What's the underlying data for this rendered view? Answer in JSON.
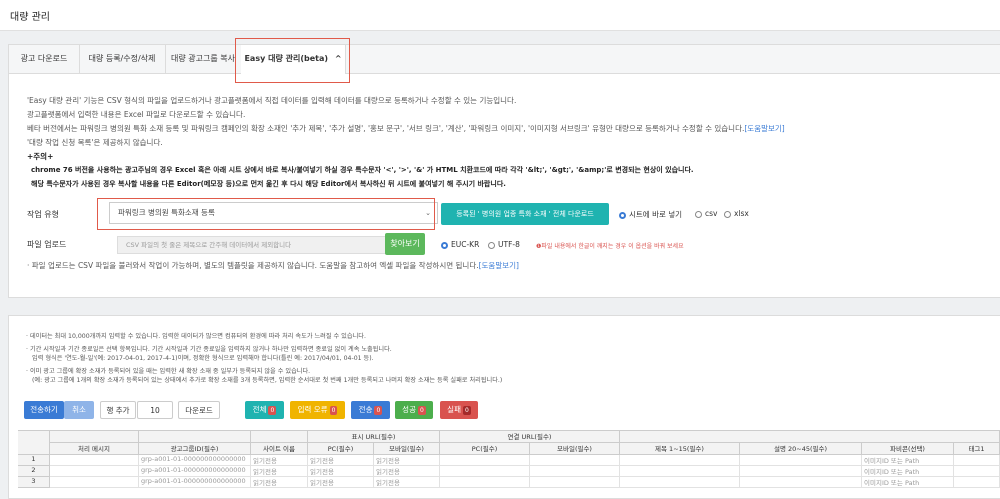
{
  "page": {
    "title": "대량 관리"
  },
  "tabs": [
    {
      "label": "광고 다운로드"
    },
    {
      "label": "대량 등록/수정/삭제"
    },
    {
      "label": "대량 광고그룹 복사"
    },
    {
      "label": "Easy 대량 관리(beta)",
      "icon": "chevron-up-icon"
    }
  ],
  "description": {
    "lines": [
      "'Easy 대량 관리' 기능은 CSV 형식의 파일을 업로드하거나 광고플랫폼에서 직접 데이터를 입력해 데이터를 대량으로 등록하거나 수정할 수 있는 기능입니다.",
      "광고플랫폼에서 입력한 내용은 Excel 파일로 다운로드할 수 있습니다.",
      "베타 버전에서는 파워링크 병의원 특화 소재 등록 및 파워링크 캠페인의 확장 소재인 '추가 제목', '추가 설명', '홍보 문구', '서브 링크', '계산', '파워링크 이미지', '이미지형 서브링크' 유형만 대량으로 등록하거나 수정할 수 있습니다.",
      "'대량 작업 신청 목록'은 제공하지 않습니다."
    ],
    "help_link": "[도움말보기]",
    "caution_title": "+주의+",
    "caution_lines": [
      "chrome 76 버전을 사용하는 광고주님의 경우 Excel 혹은 아래 시트 상에서 바로 복사/붙여넣기 하실 경우 특수문자 '<', '>', '&' 가 HTML 치환코드에 따라 각각 '&lt;', '&gt;', '&amp;'로 변경되는 현상이 있습니다.",
      "해당 특수문자가 사용된 경우 복사할 내용을 다른 Editor(메모장 등)으로 먼저 옮긴 후 다시 해당 Editor에서 복사하신 뒤 시트에 붙여넣기 해 주시기 바랍니다."
    ]
  },
  "work_type": {
    "label": "작업 유형",
    "selected": "파워링크 병의원 특화소재 등록",
    "download_button": "등록된 ' 병의원 업종 특화 소재 ' 전체 다운로드",
    "options": [
      "시트에 바로 넣기",
      "csv",
      "xlsx"
    ],
    "selected_option": "시트에 바로 넣기"
  },
  "file_upload": {
    "label": "파일 업로드",
    "placeholder": "CSV 파일의 첫 줄은 제목으로 간주해 데이터에서 제외합니다",
    "browse_button": "찾아보기",
    "encodings": [
      "EUC-KR",
      "UTF-8"
    ],
    "selected_encoding": "EUC-KR",
    "warning": "❶파일 내용에서 한글이 깨지는 경우 이 옵션을 바꿔 보세요",
    "note": "파일 업로드는 CSV 파일을 불러와서 작업이 가능하며, 별도의 템플릿을 제공하지 않습니다. 도움말을 참고하여 엑셀 파일을 작성하시면 됩니다.",
    "help_link": "[도움말보기]"
  },
  "notes": [
    "데이터는 최대 10,000개까지 입력할 수 있습니다. 입력한 데이터가 많으면 컴퓨터의 환경에 따라 처리 속도가 느려질 수 있습니다.",
    "기간 시작일과 기간 종료일은 선택 항목입니다. 기간 시작일과 기간 종료일을 입력하지 않거나 하나만 입력하면 종료일 없이 계속 노출됩니다.",
    "입력 형식은 '연도-월-일'(예: 2017-04-01, 2017-4-1)이며, 정확한 형식으로 입력해야 합니다(틀린 예: 2017/04/01, 04-01 등).",
    "이미 광고 그룹에 확장 소재가 등록되어 있을 때는 입력한 새 확장 소재 중 일부가 등록되지 않을 수 있습니다.",
    "(예: 광고 그룹에 1개의 확장 소재가 등록되어 있는 상태에서 추가로 확장 소재를 3개 등록하면, 입력한 순서대로 첫 번째 1개만 등록되고 나머지 확장 소재는 등록 실패로 처리됩니다.)"
  ],
  "toolbar": {
    "send": "전송하기",
    "cancel": "취소",
    "add_rows": "행 추가",
    "row_count": "10",
    "download": "다운로드",
    "filters": [
      {
        "label": "전체",
        "count": "0",
        "color": "#1fb3b0"
      },
      {
        "label": "입력 오류",
        "count": "0",
        "color": "#f0b400"
      },
      {
        "label": "전송",
        "count": "0",
        "color": "#3a7bd5"
      },
      {
        "label": "성공",
        "count": "0",
        "color": "#4cae4c"
      },
      {
        "label": "실패",
        "count": "0",
        "color": "#d9534f"
      }
    ]
  },
  "grid": {
    "group_headers": [
      "표시 URL(필수)",
      "연결 URL(필수)"
    ],
    "headers": [
      "처리 메시지",
      "광고그룹ID(필수)",
      "사이트 이름",
      "PC(필수)",
      "모바일(필수)",
      "PC(필수)",
      "모바일(필수)",
      "제목 1~15(필수)",
      "설명 20~45(필수)",
      "파비콘(선택)",
      "태그1"
    ],
    "rows": [
      {
        "num": "1",
        "group_id": "grp-a001-01-000000000000000",
        "site": "읽기전용",
        "pc": "읽기전용",
        "mobile": "읽기전용",
        "favicon": "이미지ID 또는 Path"
      },
      {
        "num": "2",
        "group_id": "grp-a001-01-000000000000000",
        "site": "읽기전용",
        "pc": "읽기전용",
        "mobile": "읽기전용",
        "favicon": "이미지ID 또는 Path"
      },
      {
        "num": "3",
        "group_id": "grp-a001-01-000000000000000",
        "site": "읽기전용",
        "pc": "읽기전용",
        "mobile": "읽기전용",
        "favicon": "이미지ID 또는 Path"
      }
    ]
  },
  "colors": {
    "highlight": "#e05a4a",
    "teal": "#1fb3b0",
    "green": "#5cb85c",
    "link": "#3a7bd5"
  }
}
